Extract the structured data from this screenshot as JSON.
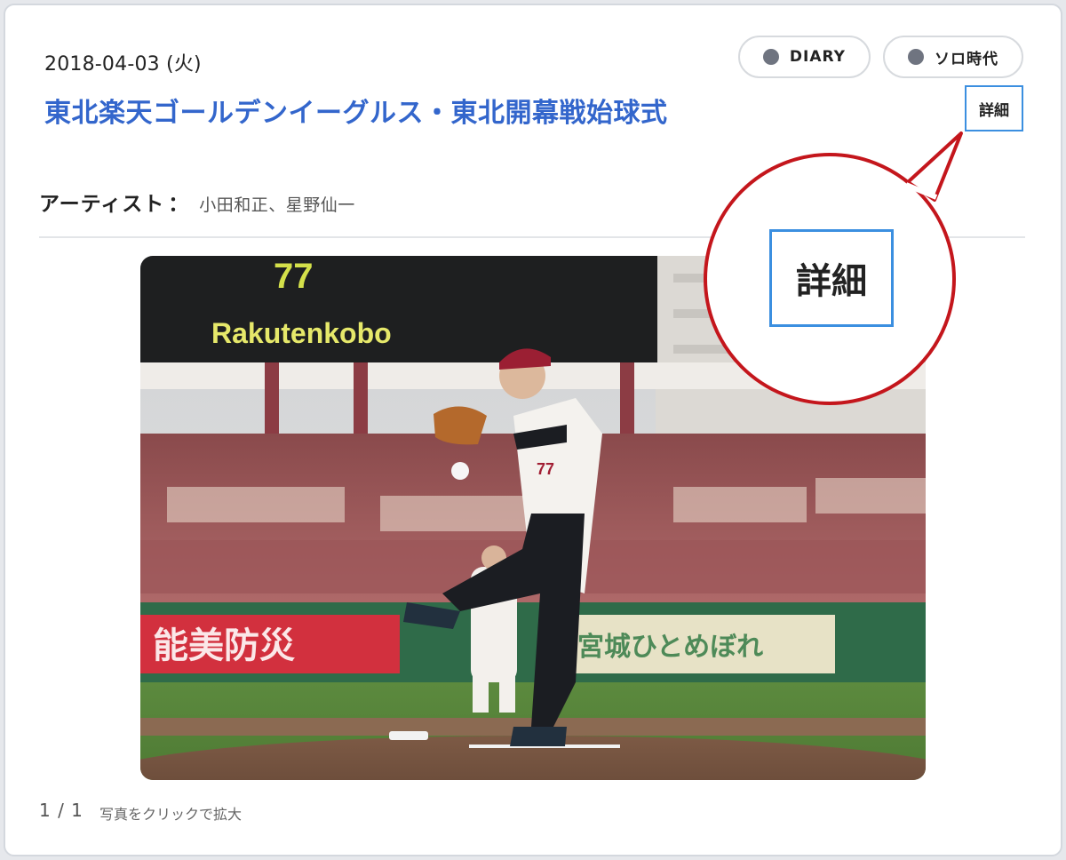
{
  "post": {
    "date": "2018-04-03 (火)",
    "title": "東北楽天ゴールデンイーグルス・東北開幕戦始球式",
    "detail_label": "詳細",
    "tags": [
      {
        "label": "DIARY",
        "dot_color": "#6f7480"
      },
      {
        "label": "ソロ時代",
        "dot_color": "#6f7480"
      }
    ],
    "artist_label": "アーティスト",
    "artist_colon": "：",
    "artists": "小田和正、星野仙一"
  },
  "gallery": {
    "pager": "1 / 1",
    "hint": "写真をクリックで拡大",
    "scoreboard_text": "77",
    "scoreboard_sponsor": "Rakutenkobo",
    "banner_left": "能美防災",
    "banner_right": "宮城ひとめぼれ"
  },
  "callout": {
    "label": "詳細",
    "border_color": "#c4161c"
  },
  "colors": {
    "accent_blue": "#3366cc",
    "button_border": "#3b8fe0"
  }
}
